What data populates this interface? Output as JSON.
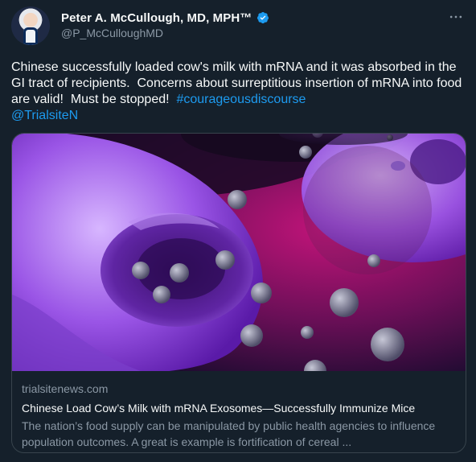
{
  "author": {
    "name": "Peter A. McCullough, MD, MPH™",
    "handle": "@P_McCulloughMD",
    "verified": true
  },
  "tweet": {
    "text_prefix": "Chinese successfully loaded cow's milk with mRNA and it was absorbed in the GI tract of recipients.  Concerns about surreptitious insertion of mRNA into food are valid!  Must be stopped!  ",
    "hashtag": "#courageousdiscourse",
    "mention": "@TrialsiteN"
  },
  "card": {
    "domain": "trialsitenews.com",
    "title": "Chinese Load Cow’s Milk with mRNA Exosomes—Successfully Immunize Mice",
    "description": "The nation’s food supply can be manipulated by public health agencies to influence population outcomes. A great is example is fortification of cereal ..."
  },
  "colors": {
    "background": "#15202b",
    "link": "#1d9bf0",
    "muted": "#8b98a5",
    "border": "#38444d"
  },
  "icons": [
    "verified-badge-icon",
    "more-options-icon"
  ]
}
